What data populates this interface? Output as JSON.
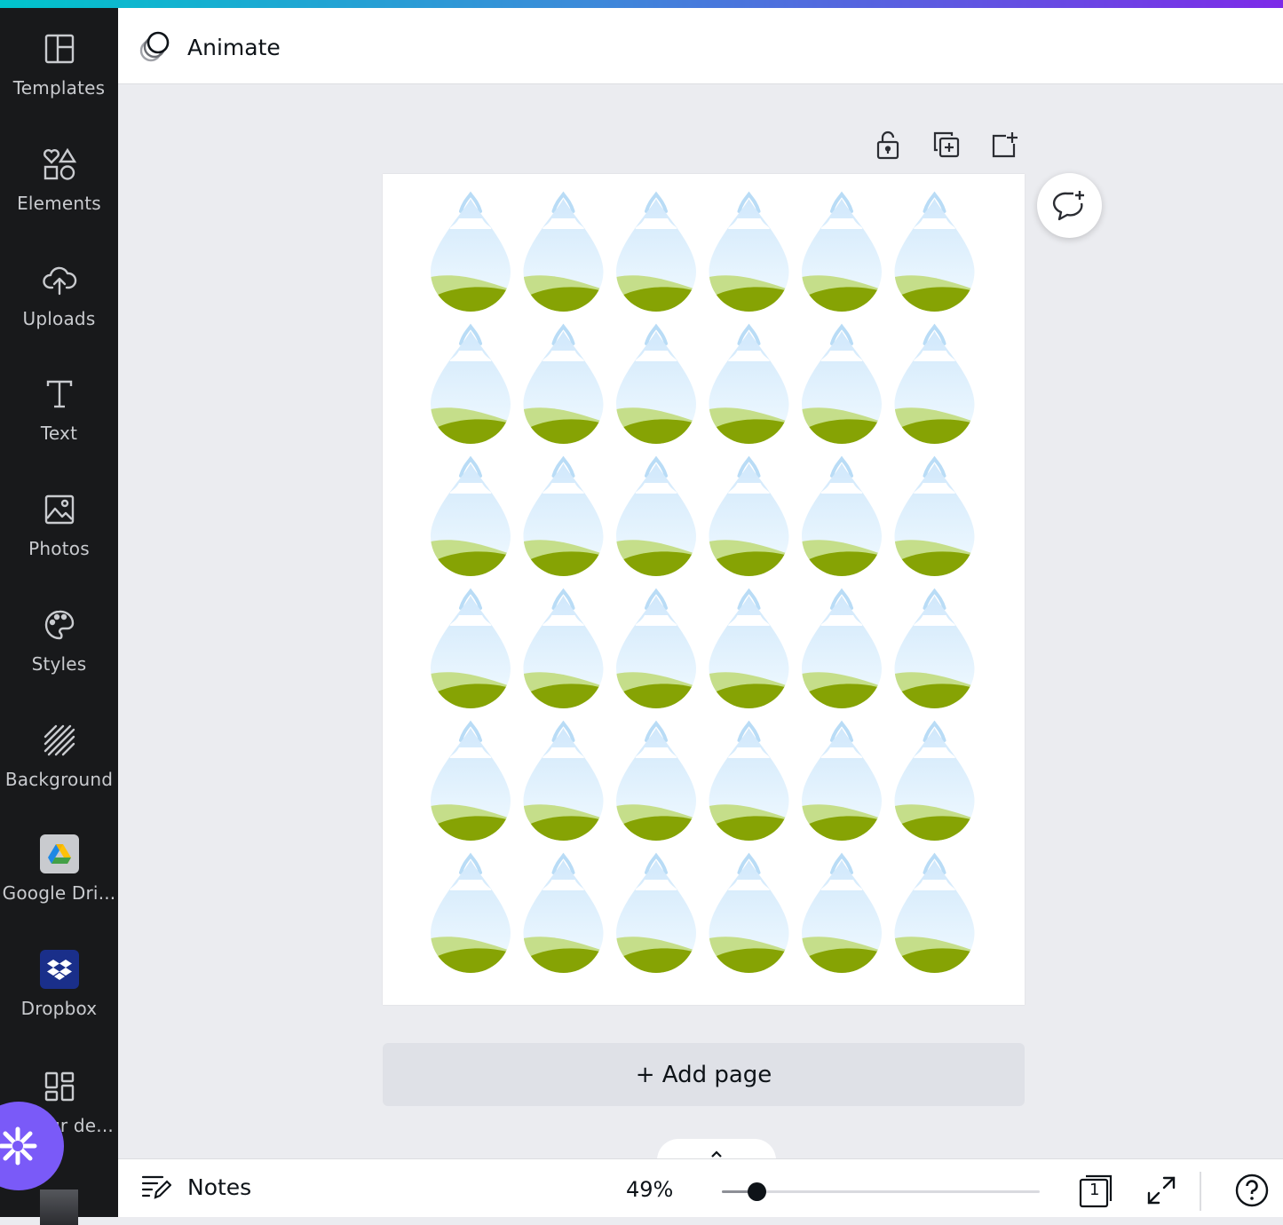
{
  "header": {
    "animate_label": "Animate"
  },
  "sidebar": {
    "items": [
      {
        "label": "Templates",
        "icon": "templates-icon"
      },
      {
        "label": "Elements",
        "icon": "elements-icon"
      },
      {
        "label": "Uploads",
        "icon": "upload-cloud-icon"
      },
      {
        "label": "Text",
        "icon": "text-icon"
      },
      {
        "label": "Photos",
        "icon": "photo-icon"
      },
      {
        "label": "Styles",
        "icon": "palette-icon"
      },
      {
        "label": "Background",
        "icon": "background-hatch-icon"
      },
      {
        "label": "Google Dri...",
        "icon": "google-drive-icon"
      },
      {
        "label": "Dropbox",
        "icon": "dropbox-icon"
      },
      {
        "label": "ur de...",
        "icon": "apps-grid-icon"
      }
    ]
  },
  "page_tools": [
    "lock-icon",
    "duplicate-page-icon",
    "add-page-icon"
  ],
  "canvas": {
    "pattern": "raindrop-landscape",
    "rows": 6,
    "cols": 6,
    "colors": {
      "sky_top": "#cfe7fb",
      "sky_bottom": "#f3fbff",
      "hill_light": "#c5de8a",
      "hill_dark": "#86a304"
    }
  },
  "add_page_label": "+ Add page",
  "footer": {
    "notes_label": "Notes",
    "zoom_label": "49%",
    "zoom_level_percent": 49,
    "page_count": "1"
  },
  "colors": {
    "accent": "#7a5af8",
    "sidebar_bg": "#18191b",
    "canvas_bg": "#ebecf0"
  }
}
